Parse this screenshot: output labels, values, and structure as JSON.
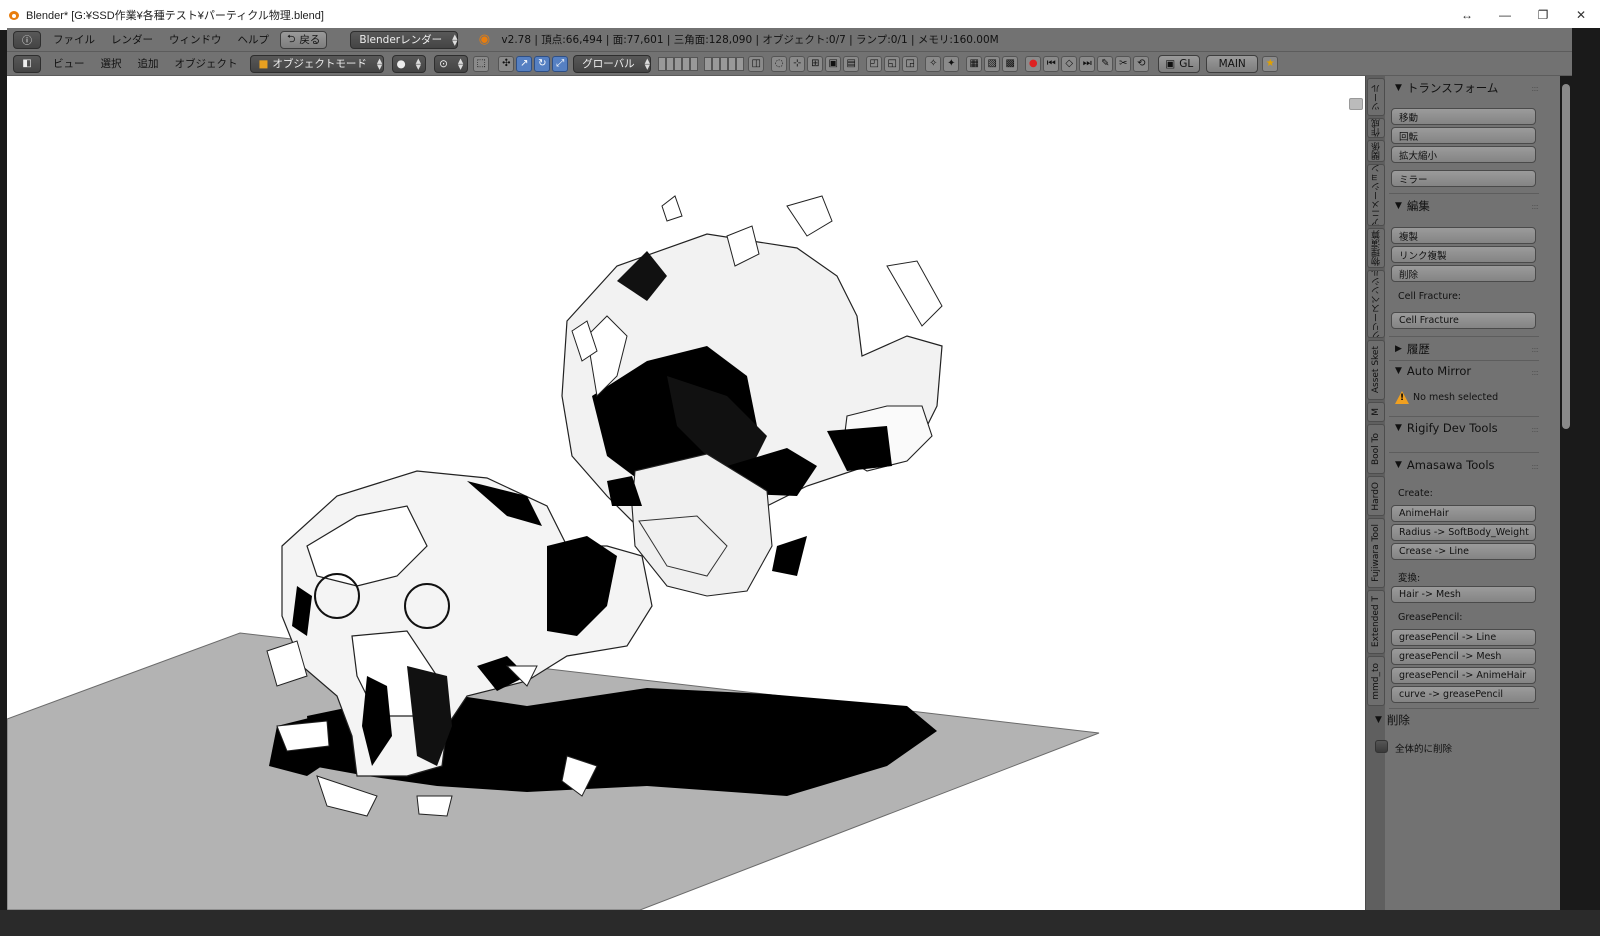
{
  "window": {
    "title": "Blender* [G:¥SSD作業¥各種テスト¥パーティクル物理.blend]",
    "controls": {
      "resize": "↔",
      "minimize": "—",
      "maximize": "❐",
      "close": "✕"
    }
  },
  "header": {
    "menus": [
      "ファイル",
      "レンダー",
      "ウィンドウ",
      "ヘルプ"
    ],
    "back_label": "戻る",
    "render_engine": "Blenderレンダー",
    "stats": "v2.78 | 頂点:66,494 | 面:77,601 | 三角面:128,090 | オブジェクト:0/7 | ランプ:0/1 | メモリ:160.00M"
  },
  "view_header": {
    "menus": [
      "ビュー",
      "選択",
      "追加",
      "オブジェクト"
    ],
    "mode": "オブジェクトモード",
    "orientation": "グローバル",
    "gl_label": "GL",
    "layer_label": "MAIN"
  },
  "tabs": [
    {
      "label": "ツール"
    },
    {
      "label": "作成"
    },
    {
      "label": "関係"
    },
    {
      "label": "アニメーション"
    },
    {
      "label": "物理演算"
    },
    {
      "label": "グリースペンシル"
    },
    {
      "label": "Asset Sket"
    },
    {
      "label": "M"
    },
    {
      "label": "Bool To"
    },
    {
      "label": "HardO"
    },
    {
      "label": "Fujiwara Tool"
    },
    {
      "label": "Extended T"
    },
    {
      "label": "mmd_to"
    }
  ],
  "panel": {
    "transform": {
      "title": "トランスフォーム",
      "buttons": [
        "移動",
        "回転",
        "拡大縮小",
        "ミラー"
      ]
    },
    "edit": {
      "title": "編集",
      "buttons": [
        "複製",
        "リンク複製",
        "削除"
      ],
      "cell_fracture_label": "Cell Fracture:",
      "cell_fracture_button": "Cell Fracture"
    },
    "history": {
      "title": "履歴"
    },
    "auto_mirror": {
      "title": "Auto Mirror",
      "warning": "No mesh selected"
    },
    "rigify": {
      "title": "Rigify Dev Tools"
    },
    "amasawa": {
      "title": "Amasawa Tools",
      "create_label": "Create:",
      "create_buttons": [
        "AnimeHair",
        "Radius -> SoftBody_Weight",
        "Crease -> Line"
      ],
      "convert_label": "変換:",
      "convert_buttons": [
        "Hair -> Mesh"
      ],
      "grease_label": "GreasePencil:",
      "grease_buttons": [
        "greasePencil -> Line",
        "greasePencil -> Mesh",
        "greasePencil -> AnimeHair",
        "curve -> greasePencil"
      ]
    },
    "delete": {
      "title": "削除",
      "checkbox_label": "全体的に削除"
    }
  },
  "colors": {
    "header_bg": "#727272",
    "viewport_bg": "#ffffff",
    "floor": "#b3b3b3",
    "accent_orange": "#e87d0d"
  }
}
